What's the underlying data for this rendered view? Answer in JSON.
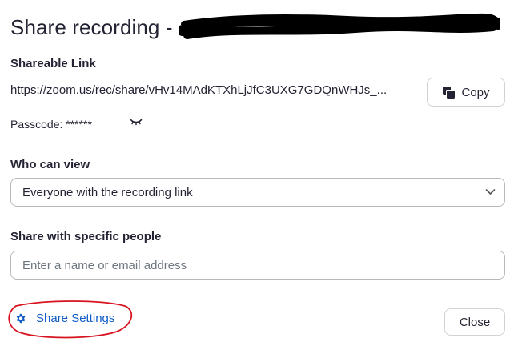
{
  "dialog": {
    "title": "Share recording -",
    "title_redacted": true
  },
  "shareable_link": {
    "label": "Shareable Link",
    "url": "https://zoom.us/rec/share/vHv14MAdKTXhLjJfC3UXG7GDQnWHJs_...",
    "copy_button_label": "Copy",
    "copy_icon": "copy-icon"
  },
  "passcode": {
    "text": "Passcode: ******",
    "toggle_icon": "eye-closed-icon"
  },
  "who_can_view": {
    "label": "Who can view",
    "selected": "Everyone with the recording link",
    "icon": "chevron-down-icon"
  },
  "share_specific": {
    "label": "Share with specific people",
    "placeholder": "Enter a name or email address",
    "value": ""
  },
  "footer": {
    "share_settings_label": "Share Settings",
    "share_settings_icon": "gear-icon",
    "close_label": "Close"
  },
  "colors": {
    "text": "#232333",
    "link": "#0e5bc7",
    "border": "#b7b9bd",
    "annotation": "#d7141f",
    "redaction": "#000000"
  }
}
